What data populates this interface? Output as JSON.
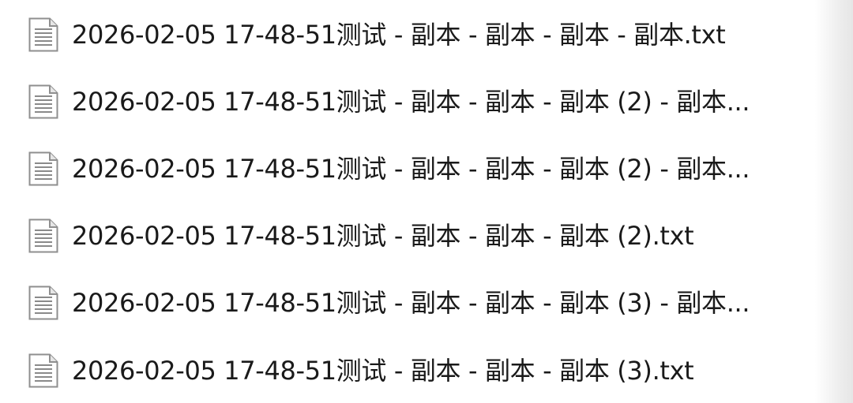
{
  "files": [
    {
      "name": "2026-02-05 17-48-51测试 - 副本 - 副本 - 副本 - 副本.txt",
      "icon": "text-file-icon"
    },
    {
      "name": "2026-02-05 17-48-51测试 - 副本 - 副本 - 副本 (2) - 副本...",
      "icon": "text-file-icon"
    },
    {
      "name": "2026-02-05 17-48-51测试 - 副本 - 副本 - 副本 (2) - 副本...",
      "icon": "text-file-icon"
    },
    {
      "name": "2026-02-05 17-48-51测试 - 副本 - 副本 - 副本 (2).txt",
      "icon": "text-file-icon"
    },
    {
      "name": "2026-02-05 17-48-51测试 - 副本 - 副本 - 副本 (3) - 副本...",
      "icon": "text-file-icon"
    },
    {
      "name": "2026-02-05 17-48-51测试 - 副本 - 副本 - 副本 (3).txt",
      "icon": "text-file-icon"
    }
  ]
}
